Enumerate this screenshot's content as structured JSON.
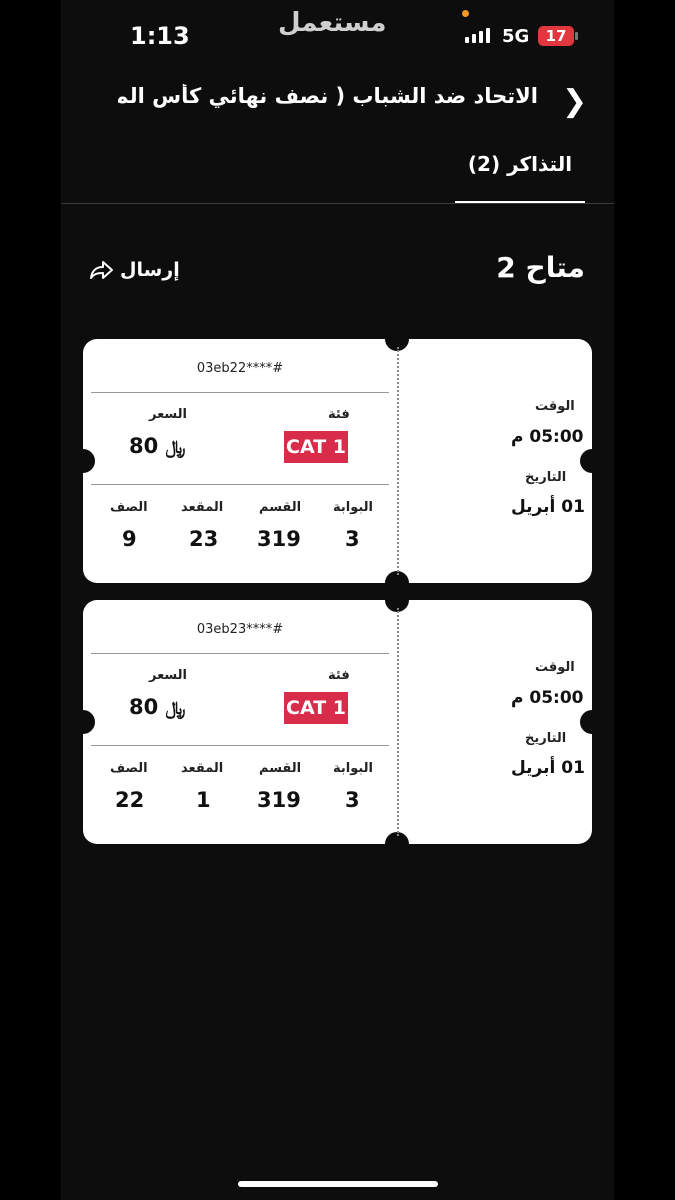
{
  "status_bar": {
    "time": "1:13",
    "watermark": "مستعمل",
    "network": "5G",
    "battery": "17"
  },
  "header": {
    "back_icon": "chevron-right-icon",
    "title": "الاتحاد ضد الشباب ( نصف نهائي كأس المل...",
    "tab_label": "التذاكر (2)"
  },
  "summary": {
    "available": "متاح 2",
    "send_label": "إرسال",
    "send_icon": "share-arrow-icon"
  },
  "labels": {
    "category": "فئة",
    "price": "السعر",
    "gate": "البوابة",
    "section": "القسم",
    "seat": "المقعد",
    "row": "الصف",
    "time": "الوقت",
    "date": "التاريخ"
  },
  "tickets": [
    {
      "code": "03eb22****#",
      "category": "CAT 1",
      "price": "80",
      "gate": "3",
      "section": "319",
      "seat": "23",
      "row": "9",
      "time": "05:00 م",
      "date": "01 أبريل"
    },
    {
      "code": "03eb23****#",
      "category": "CAT 1",
      "price": "80",
      "gate": "3",
      "section": "319",
      "seat": "1",
      "row": "22",
      "time": "05:00 م",
      "date": "01 أبريل"
    }
  ],
  "colors": {
    "accent": "#d92b4a",
    "background": "#0d0d0d",
    "ticket": "#ffffff"
  }
}
